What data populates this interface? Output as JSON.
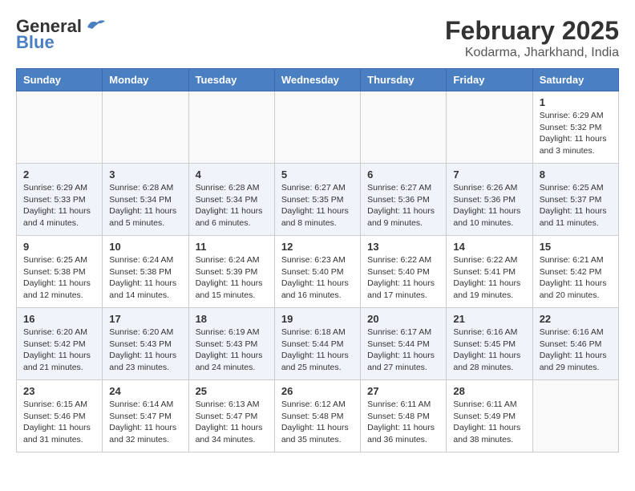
{
  "header": {
    "logo_general": "General",
    "logo_blue": "Blue",
    "month_title": "February 2025",
    "location": "Kodarma, Jharkhand, India"
  },
  "weekdays": [
    "Sunday",
    "Monday",
    "Tuesday",
    "Wednesday",
    "Thursday",
    "Friday",
    "Saturday"
  ],
  "weeks": [
    [
      {
        "day": "",
        "info": ""
      },
      {
        "day": "",
        "info": ""
      },
      {
        "day": "",
        "info": ""
      },
      {
        "day": "",
        "info": ""
      },
      {
        "day": "",
        "info": ""
      },
      {
        "day": "",
        "info": ""
      },
      {
        "day": "1",
        "info": "Sunrise: 6:29 AM\nSunset: 5:32 PM\nDaylight: 11 hours\nand 3 minutes."
      }
    ],
    [
      {
        "day": "2",
        "info": "Sunrise: 6:29 AM\nSunset: 5:33 PM\nDaylight: 11 hours\nand 4 minutes."
      },
      {
        "day": "3",
        "info": "Sunrise: 6:28 AM\nSunset: 5:34 PM\nDaylight: 11 hours\nand 5 minutes."
      },
      {
        "day": "4",
        "info": "Sunrise: 6:28 AM\nSunset: 5:34 PM\nDaylight: 11 hours\nand 6 minutes."
      },
      {
        "day": "5",
        "info": "Sunrise: 6:27 AM\nSunset: 5:35 PM\nDaylight: 11 hours\nand 8 minutes."
      },
      {
        "day": "6",
        "info": "Sunrise: 6:27 AM\nSunset: 5:36 PM\nDaylight: 11 hours\nand 9 minutes."
      },
      {
        "day": "7",
        "info": "Sunrise: 6:26 AM\nSunset: 5:36 PM\nDaylight: 11 hours\nand 10 minutes."
      },
      {
        "day": "8",
        "info": "Sunrise: 6:25 AM\nSunset: 5:37 PM\nDaylight: 11 hours\nand 11 minutes."
      }
    ],
    [
      {
        "day": "9",
        "info": "Sunrise: 6:25 AM\nSunset: 5:38 PM\nDaylight: 11 hours\nand 12 minutes."
      },
      {
        "day": "10",
        "info": "Sunrise: 6:24 AM\nSunset: 5:38 PM\nDaylight: 11 hours\nand 14 minutes."
      },
      {
        "day": "11",
        "info": "Sunrise: 6:24 AM\nSunset: 5:39 PM\nDaylight: 11 hours\nand 15 minutes."
      },
      {
        "day": "12",
        "info": "Sunrise: 6:23 AM\nSunset: 5:40 PM\nDaylight: 11 hours\nand 16 minutes."
      },
      {
        "day": "13",
        "info": "Sunrise: 6:22 AM\nSunset: 5:40 PM\nDaylight: 11 hours\nand 17 minutes."
      },
      {
        "day": "14",
        "info": "Sunrise: 6:22 AM\nSunset: 5:41 PM\nDaylight: 11 hours\nand 19 minutes."
      },
      {
        "day": "15",
        "info": "Sunrise: 6:21 AM\nSunset: 5:42 PM\nDaylight: 11 hours\nand 20 minutes."
      }
    ],
    [
      {
        "day": "16",
        "info": "Sunrise: 6:20 AM\nSunset: 5:42 PM\nDaylight: 11 hours\nand 21 minutes."
      },
      {
        "day": "17",
        "info": "Sunrise: 6:20 AM\nSunset: 5:43 PM\nDaylight: 11 hours\nand 23 minutes."
      },
      {
        "day": "18",
        "info": "Sunrise: 6:19 AM\nSunset: 5:43 PM\nDaylight: 11 hours\nand 24 minutes."
      },
      {
        "day": "19",
        "info": "Sunrise: 6:18 AM\nSunset: 5:44 PM\nDaylight: 11 hours\nand 25 minutes."
      },
      {
        "day": "20",
        "info": "Sunrise: 6:17 AM\nSunset: 5:44 PM\nDaylight: 11 hours\nand 27 minutes."
      },
      {
        "day": "21",
        "info": "Sunrise: 6:16 AM\nSunset: 5:45 PM\nDaylight: 11 hours\nand 28 minutes."
      },
      {
        "day": "22",
        "info": "Sunrise: 6:16 AM\nSunset: 5:46 PM\nDaylight: 11 hours\nand 29 minutes."
      }
    ],
    [
      {
        "day": "23",
        "info": "Sunrise: 6:15 AM\nSunset: 5:46 PM\nDaylight: 11 hours\nand 31 minutes."
      },
      {
        "day": "24",
        "info": "Sunrise: 6:14 AM\nSunset: 5:47 PM\nDaylight: 11 hours\nand 32 minutes."
      },
      {
        "day": "25",
        "info": "Sunrise: 6:13 AM\nSunset: 5:47 PM\nDaylight: 11 hours\nand 34 minutes."
      },
      {
        "day": "26",
        "info": "Sunrise: 6:12 AM\nSunset: 5:48 PM\nDaylight: 11 hours\nand 35 minutes."
      },
      {
        "day": "27",
        "info": "Sunrise: 6:11 AM\nSunset: 5:48 PM\nDaylight: 11 hours\nand 36 minutes."
      },
      {
        "day": "28",
        "info": "Sunrise: 6:11 AM\nSunset: 5:49 PM\nDaylight: 11 hours\nand 38 minutes."
      },
      {
        "day": "",
        "info": ""
      }
    ]
  ]
}
